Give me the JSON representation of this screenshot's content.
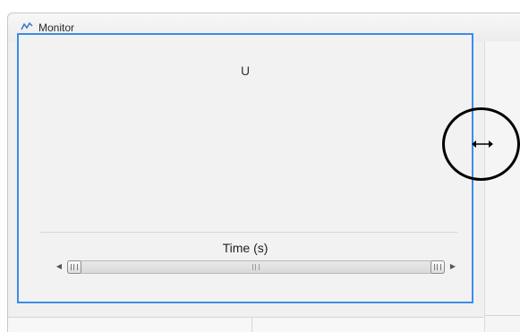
{
  "window": {
    "title": "Monitor"
  },
  "plot": {
    "signal_title": "U",
    "x_axis_label": "Time (s)"
  },
  "scrollbar": {
    "left_arrow": "◀",
    "right_arrow": "▶"
  },
  "colors": {
    "selection_border": "#3c8de8",
    "annotation_circle": "#000000"
  },
  "icons": {
    "title_icon": "monitor-signal-icon",
    "cursor": "horizontal-resize-cursor-icon"
  }
}
